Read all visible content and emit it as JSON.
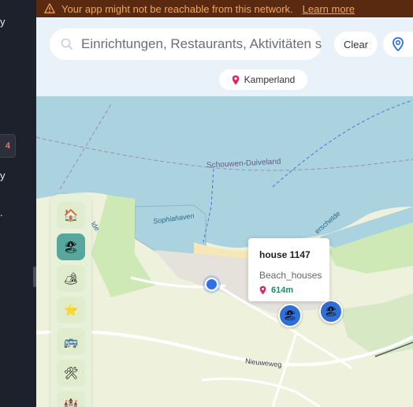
{
  "sidebar": {
    "fragments": [
      "y",
      "y",
      "."
    ],
    "badge": "4"
  },
  "warning": {
    "message": "Your app might not be reachable from this network.",
    "link": "Learn more"
  },
  "search": {
    "placeholder": "Einrichtungen, Restaurants, Aktivitäten s",
    "clear_label": "Clear"
  },
  "filter_chip": {
    "label": "Kamperland"
  },
  "map": {
    "labels": {
      "region": "Schouwen-Duiveland",
      "harbour": "Sophiahaven",
      "road": "Nieuweweg",
      "water_left": "lde",
      "water_right": "erschelde"
    }
  },
  "categories": [
    {
      "name": "home",
      "icon": "🏠",
      "active": false
    },
    {
      "name": "beach",
      "icon": "🏖",
      "active": true
    },
    {
      "name": "camping",
      "icon": "🏕",
      "active": false
    },
    {
      "name": "favorites",
      "icon": "⭐",
      "active": false
    },
    {
      "name": "transport",
      "icon": "🚌",
      "active": false
    },
    {
      "name": "tools",
      "icon": "🛠",
      "active": false
    },
    {
      "name": "more",
      "icon": "🏰",
      "active": false
    }
  ],
  "popup": {
    "title": "house 1147",
    "type": "Beach_houses",
    "distance": "614m"
  },
  "colors": {
    "water": "#aad3df",
    "land": "#eef2dd",
    "park": "#cfe9b6",
    "accent": "#2f6fd6",
    "warning_bg": "#5a2a10",
    "warning_text": "#f5a45a"
  }
}
